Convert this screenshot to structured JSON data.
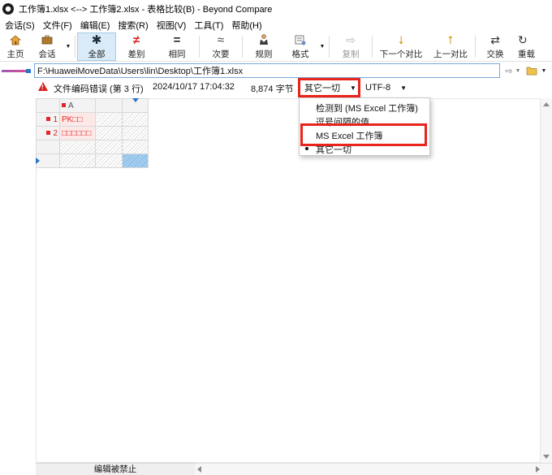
{
  "window": {
    "title": "工作簿1.xlsx <--> 工作簿2.xlsx - 表格比较(B) - Beyond Compare"
  },
  "menubar": {
    "items": [
      "会话(S)",
      "文件(F)",
      "编辑(E)",
      "搜索(R)",
      "视图(V)",
      "工具(T)",
      "帮助(H)"
    ]
  },
  "toolbar": {
    "home": {
      "label": "主页",
      "icon": "home-icon"
    },
    "session": {
      "label": "会话",
      "icon": "briefcase-icon"
    },
    "all": {
      "label": "全部",
      "icon": "asterisk-icon",
      "glyph": "✱"
    },
    "diff": {
      "label": "差别",
      "icon": "not-equal-icon",
      "glyph": "≠"
    },
    "same": {
      "label": "相同",
      "icon": "equal-icon",
      "glyph": "="
    },
    "minor": {
      "label": "次要",
      "icon": "approx-icon",
      "glyph": "≈"
    },
    "rules": {
      "label": "规则",
      "icon": "referee-icon"
    },
    "format": {
      "label": "格式",
      "icon": "format-icon"
    },
    "copy": {
      "label": "复制",
      "icon": "copy-arrow-icon",
      "glyph": "⇨"
    },
    "next": {
      "label": "下一个对比",
      "icon": "arrow-down-icon",
      "glyph": "⭣"
    },
    "prev": {
      "label": "上一对比",
      "icon": "arrow-up-icon",
      "glyph": "⭡"
    },
    "swap": {
      "label": "交换",
      "icon": "swap-icon",
      "glyph": "⇄"
    },
    "reload": {
      "label": "重载",
      "icon": "reload-icon",
      "glyph": "↻"
    }
  },
  "path": {
    "value": "F:\\HuaweiMoveData\\Users\\lin\\Desktop\\工作簿1.xlsx"
  },
  "infobar": {
    "error": "文件编码错误 (第 3 行)",
    "timestamp": "2024/10/17 17:04:32",
    "size": "8,874 字节",
    "format_selected": "其它一切",
    "encoding": "UTF-8"
  },
  "dropdown": {
    "items": [
      "检测到 (MS Excel 工作簿)",
      "逗号间隔的值",
      "MS Excel 工作簿",
      "其它一切"
    ],
    "selected_index": 3
  },
  "sheet": {
    "column_header": "A",
    "rows": [
      {
        "num": "1",
        "value": "PK□□"
      },
      {
        "num": "2",
        "value": "□□□□□□"
      }
    ]
  },
  "status": {
    "text": "编辑被禁止"
  },
  "colors": {
    "highlight_box": "#e8231b",
    "diff_text": "#e02727",
    "path_border": "#7aa7d8",
    "active_button": "#d9eaf8"
  }
}
